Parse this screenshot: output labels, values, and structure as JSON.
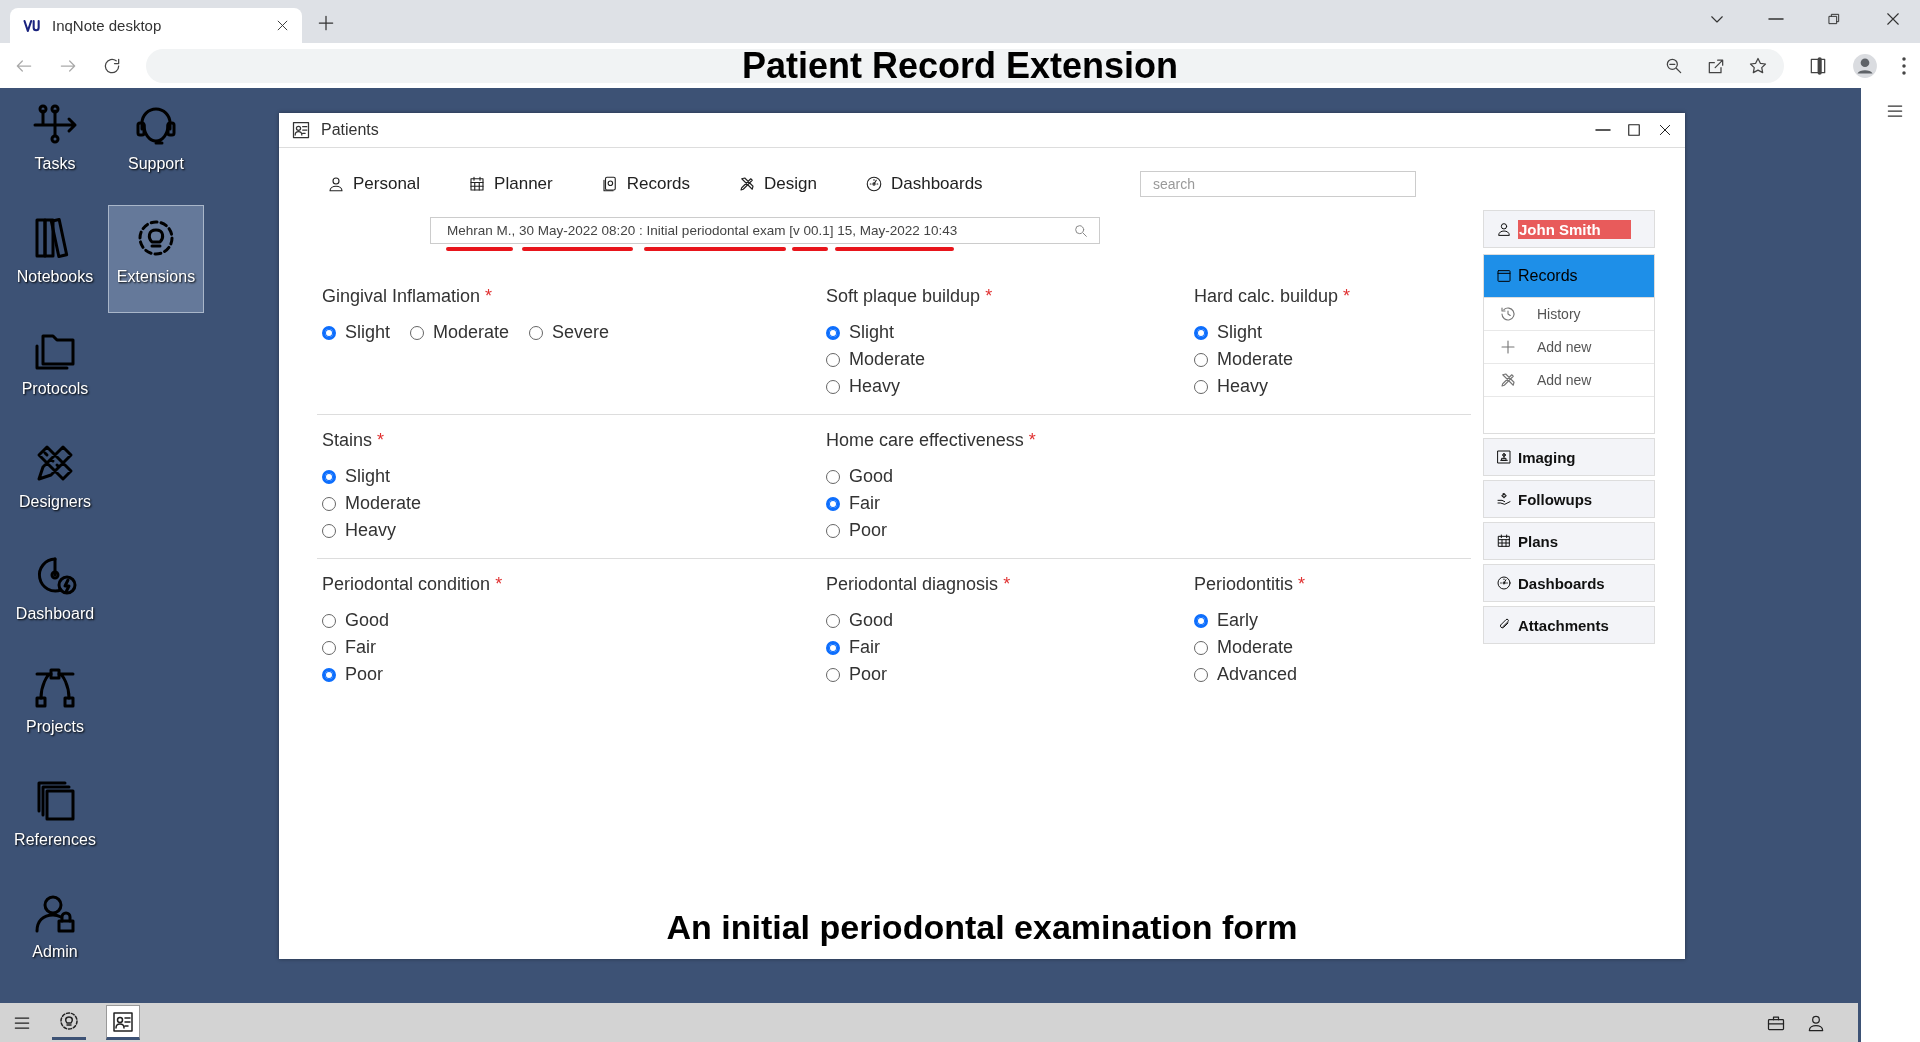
{
  "browser": {
    "tab_title": "InqNote desktop",
    "heading": "Patient Record Extension"
  },
  "desktop_icons": [
    {
      "label": "Tasks",
      "selected": false
    },
    {
      "label": "Support",
      "selected": false
    },
    {
      "label": "Notebooks",
      "selected": false
    },
    {
      "label": "Extensions",
      "selected": true
    },
    {
      "label": "Protocols",
      "selected": false
    },
    {
      "label": "Designers",
      "selected": false
    },
    {
      "label": "Dashboard",
      "selected": false
    },
    {
      "label": "Projects",
      "selected": false
    },
    {
      "label": "References",
      "selected": false
    },
    {
      "label": "Admin",
      "selected": false
    }
  ],
  "window": {
    "title": "Patients",
    "tabs": [
      {
        "label": "Personal"
      },
      {
        "label": "Planner"
      },
      {
        "label": "Records"
      },
      {
        "label": "Design"
      },
      {
        "label": "Dashboards"
      }
    ],
    "search": {
      "placeholder": "search"
    },
    "record_field": {
      "value": "Mehran M., 30 May-2022 08:20 : Initial periodontal exam [v 00.1] 15, May-2022 10:43"
    },
    "form_rows": [
      [
        {
          "label": "Gingival Inflamation",
          "marker": "*",
          "kind": "inline",
          "options": [
            {
              "label": "Slight",
              "selected": true
            },
            {
              "label": "Moderate",
              "selected": false
            },
            {
              "label": "Severe",
              "selected": false
            }
          ]
        },
        {
          "label": "Soft plaque buildup",
          "marker": "*",
          "kind": "stacked",
          "options": [
            {
              "label": "Slight",
              "selected": true
            },
            {
              "label": "Moderate",
              "selected": false
            },
            {
              "label": "Heavy",
              "selected": false
            }
          ]
        },
        {
          "label": "Hard calc. buildup",
          "marker": "*",
          "kind": "stacked",
          "options": [
            {
              "label": "Slight",
              "selected": true
            },
            {
              "label": "Moderate",
              "selected": false
            },
            {
              "label": "Heavy",
              "selected": false
            }
          ]
        }
      ],
      [
        {
          "label": "Stains",
          "marker": "*",
          "kind": "stacked",
          "options": [
            {
              "label": "Slight",
              "selected": true
            },
            {
              "label": "Moderate",
              "selected": false
            },
            {
              "label": "Heavy",
              "selected": false
            }
          ]
        },
        {
          "label": "Home care effectiveness",
          "marker": "*",
          "kind": "stacked",
          "options": [
            {
              "label": "Good",
              "selected": false
            },
            {
              "label": "Fair",
              "selected": true
            },
            {
              "label": "Poor",
              "selected": false
            }
          ]
        }
      ],
      [
        {
          "label": "Periodontal condition",
          "marker": "*",
          "kind": "stacked",
          "options": [
            {
              "label": "Good",
              "selected": false
            },
            {
              "label": "Fair",
              "selected": false
            },
            {
              "label": "Poor",
              "selected": true
            }
          ]
        },
        {
          "label": "Periodontal diagnosis",
          "marker": "*",
          "kind": "stacked",
          "options": [
            {
              "label": "Good",
              "selected": false
            },
            {
              "label": "Fair",
              "selected": true
            },
            {
              "label": "Poor",
              "selected": false
            }
          ]
        },
        {
          "label": "Periodontitis",
          "marker": "*",
          "kind": "stacked",
          "options": [
            {
              "label": "Early",
              "selected": true
            },
            {
              "label": "Moderate",
              "selected": false
            },
            {
              "label": "Advanced",
              "selected": false
            }
          ]
        }
      ]
    ],
    "patient": {
      "name": "John Smith"
    },
    "panel_sections": [
      {
        "label": "Records",
        "selected": true,
        "items": [
          {
            "label": "History"
          },
          {
            "label": "Add new"
          },
          {
            "label": "Add new"
          }
        ]
      },
      {
        "label": "Imaging",
        "selected": false
      },
      {
        "label": "Followups",
        "selected": false
      },
      {
        "label": "Plans",
        "selected": false
      },
      {
        "label": "Dashboards",
        "selected": false
      },
      {
        "label": "Attachments",
        "selected": false
      }
    ],
    "caption": "An initial periodontal examination form"
  },
  "taskbar": {
    "apps": [
      {
        "selected": false
      },
      {
        "selected": true
      }
    ]
  }
}
